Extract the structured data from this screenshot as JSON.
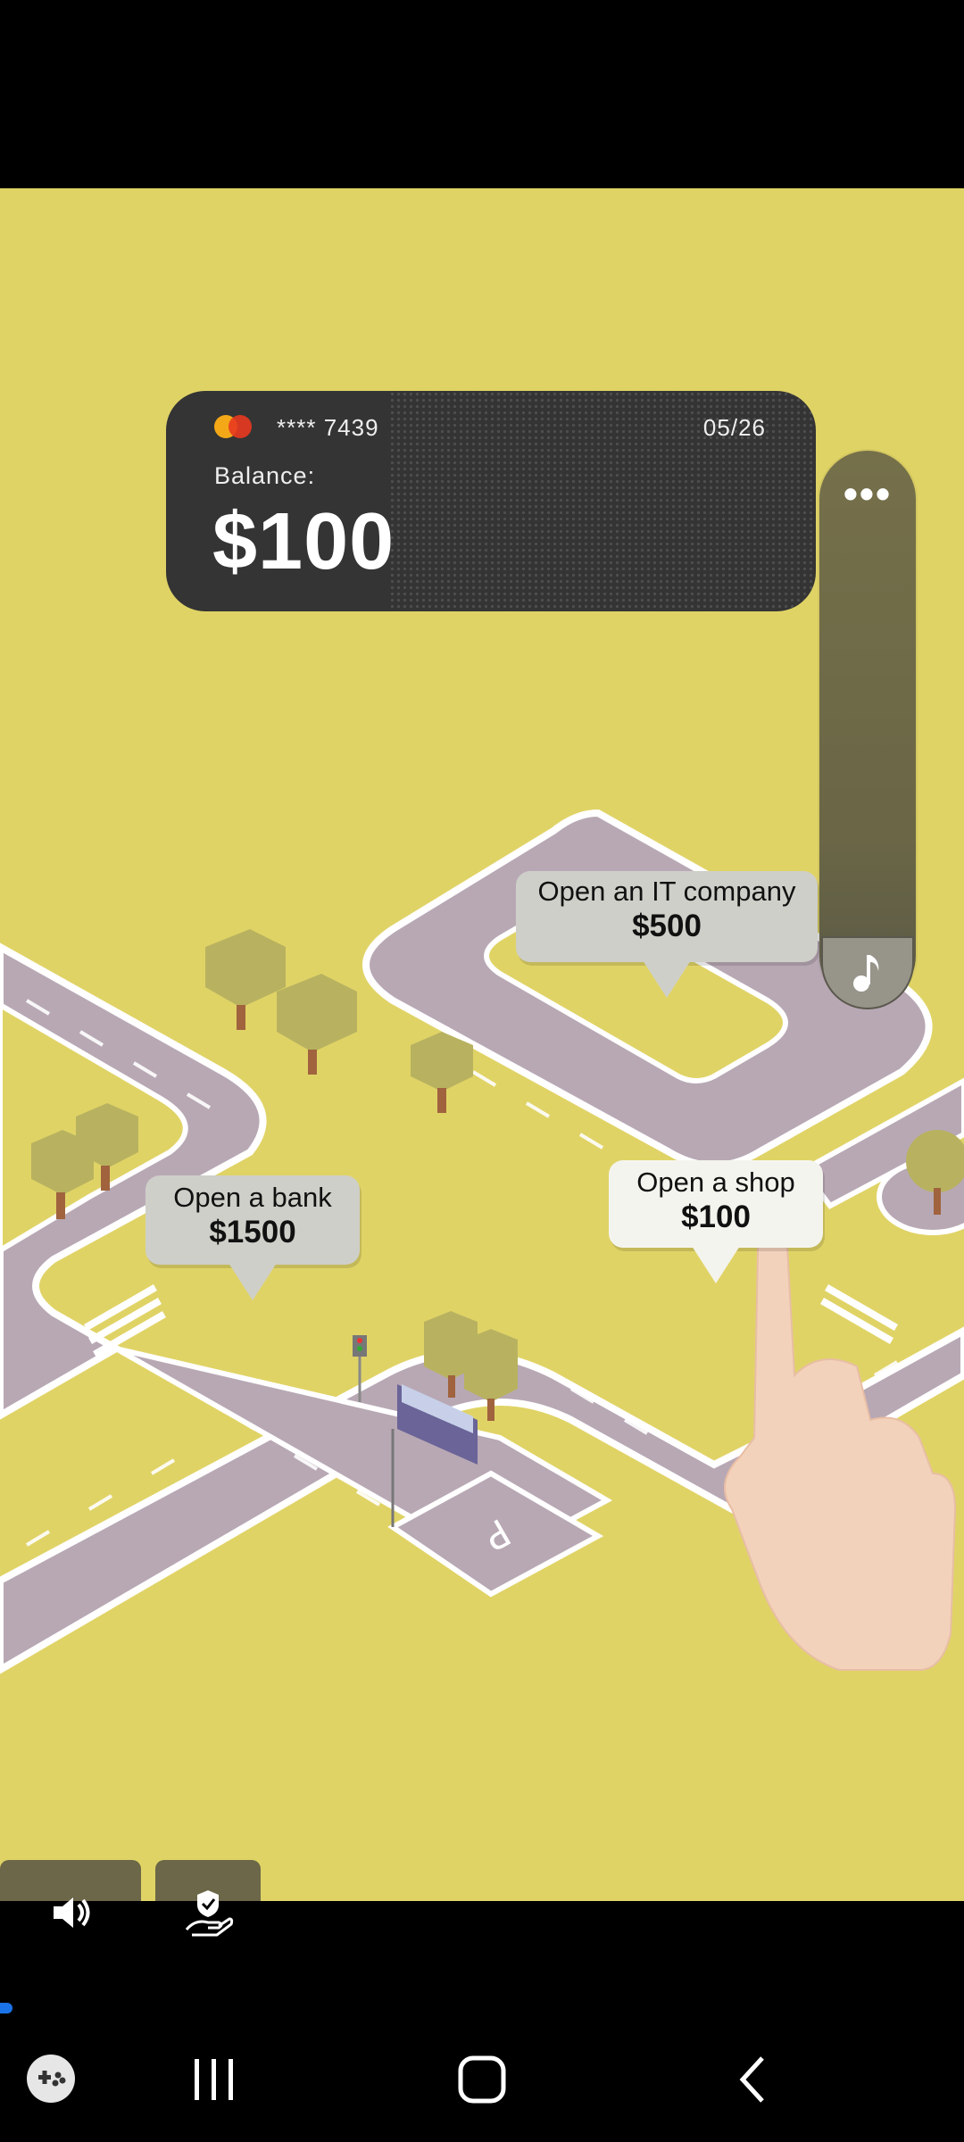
{
  "card": {
    "number": "**** 7439",
    "expiry": "05/26",
    "balance_label": "Balance:",
    "balance": "$100"
  },
  "side_panel": {
    "more_label": "•••"
  },
  "bubbles": {
    "it_company": {
      "title": "Open an IT company",
      "price": "$500"
    },
    "bank": {
      "title": "Open a bank",
      "price": "$1500"
    },
    "shop": {
      "title": "Open a shop",
      "price": "$100"
    }
  },
  "colors": {
    "background": "#e0d366",
    "road": "#b8a8b4",
    "card": "#343434"
  },
  "icons": {
    "sound": "speaker-icon",
    "shield_hand": "shield-hand-icon",
    "music": "music-note-icon",
    "gamepad": "gamepad-icon"
  }
}
